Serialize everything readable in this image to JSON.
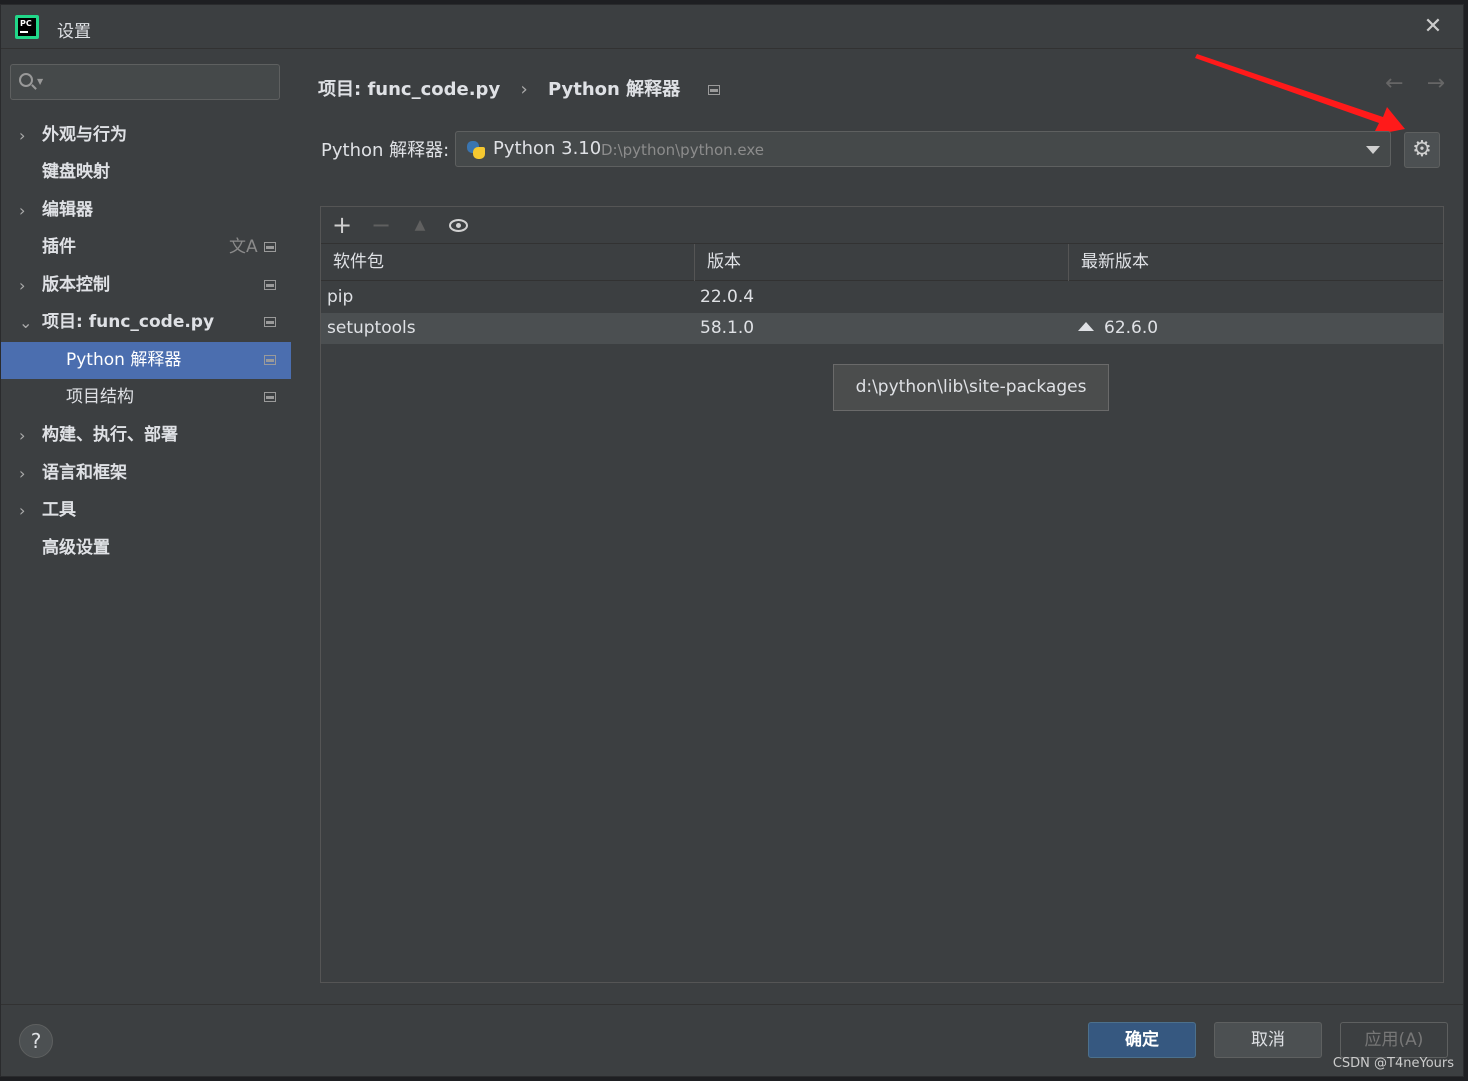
{
  "window": {
    "title": "设置",
    "app_icon_text": "PC"
  },
  "search": {
    "placeholder": ""
  },
  "sidebar": {
    "items": [
      {
        "label": "外观与行为",
        "chevron": "›"
      },
      {
        "label": "键盘映射"
      },
      {
        "label": "编辑器",
        "chevron": "›"
      },
      {
        "label": "插件",
        "icon": "文A"
      },
      {
        "label": "版本控制",
        "chevron": "›"
      },
      {
        "label": "项目: func_code.py",
        "chevron": "⌄"
      },
      {
        "label": "Python 解释器"
      },
      {
        "label": "项目结构"
      },
      {
        "label": "构建、执行、部署",
        "chevron": "›"
      },
      {
        "label": "语言和框架",
        "chevron": "›"
      },
      {
        "label": "工具",
        "chevron": "›"
      },
      {
        "label": "高级设置"
      }
    ]
  },
  "breadcrumb": {
    "project": "项目: func_code.py",
    "separator": "›",
    "page": "Python 解释器"
  },
  "nav": {
    "back": "←",
    "forward": "→"
  },
  "interpreter": {
    "label": "Python 解释器:",
    "name": "Python 3.10",
    "path": "D:\\python\\python.exe"
  },
  "packages": {
    "columns": [
      "软件包",
      "版本",
      "最新版本"
    ],
    "rows": [
      {
        "name": "pip",
        "version": "22.0.4",
        "latest": ""
      },
      {
        "name": "setuptools",
        "version": "58.1.0",
        "latest": "62.6.0"
      }
    ],
    "tooltip": "d:\\python\\lib\\site-packages"
  },
  "toolbar": {
    "add": "+",
    "remove": "−",
    "upgrade": "▲"
  },
  "footer": {
    "help": "?",
    "ok": "确定",
    "cancel": "取消",
    "apply": "应用(A)"
  },
  "watermark": "CSDN @T4neYours",
  "colors": {
    "accent": "#4b6eaf",
    "ok_button": "#365880",
    "arrow": "#ff1a1a"
  }
}
